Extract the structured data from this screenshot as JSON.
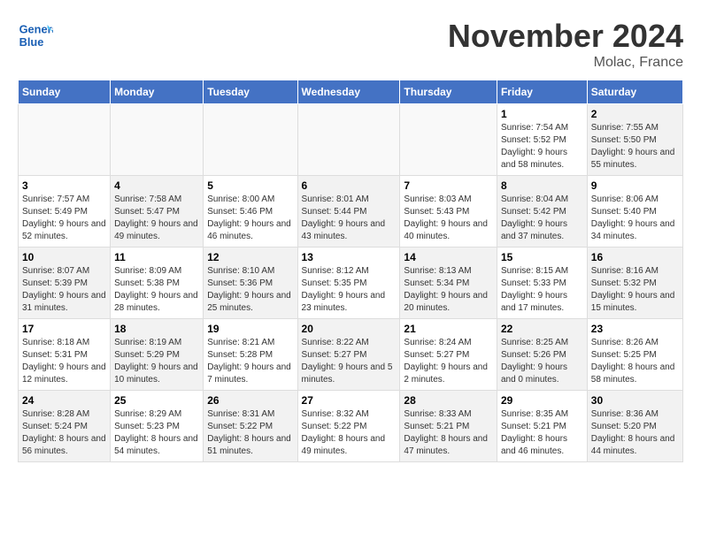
{
  "header": {
    "logo_line1": "General",
    "logo_line2": "Blue",
    "month_title": "November 2024",
    "location": "Molac, France"
  },
  "weekdays": [
    "Sunday",
    "Monday",
    "Tuesday",
    "Wednesday",
    "Thursday",
    "Friday",
    "Saturday"
  ],
  "weeks": [
    [
      {
        "day": "",
        "info": "",
        "shaded": true
      },
      {
        "day": "",
        "info": "",
        "shaded": true
      },
      {
        "day": "",
        "info": "",
        "shaded": true
      },
      {
        "day": "",
        "info": "",
        "shaded": true
      },
      {
        "day": "",
        "info": "",
        "shaded": true
      },
      {
        "day": "1",
        "info": "Sunrise: 7:54 AM\nSunset: 5:52 PM\nDaylight: 9 hours and 58 minutes.",
        "shaded": false
      },
      {
        "day": "2",
        "info": "Sunrise: 7:55 AM\nSunset: 5:50 PM\nDaylight: 9 hours and 55 minutes.",
        "shaded": true
      }
    ],
    [
      {
        "day": "3",
        "info": "Sunrise: 7:57 AM\nSunset: 5:49 PM\nDaylight: 9 hours and 52 minutes.",
        "shaded": false
      },
      {
        "day": "4",
        "info": "Sunrise: 7:58 AM\nSunset: 5:47 PM\nDaylight: 9 hours and 49 minutes.",
        "shaded": true
      },
      {
        "day": "5",
        "info": "Sunrise: 8:00 AM\nSunset: 5:46 PM\nDaylight: 9 hours and 46 minutes.",
        "shaded": false
      },
      {
        "day": "6",
        "info": "Sunrise: 8:01 AM\nSunset: 5:44 PM\nDaylight: 9 hours and 43 minutes.",
        "shaded": true
      },
      {
        "day": "7",
        "info": "Sunrise: 8:03 AM\nSunset: 5:43 PM\nDaylight: 9 hours and 40 minutes.",
        "shaded": false
      },
      {
        "day": "8",
        "info": "Sunrise: 8:04 AM\nSunset: 5:42 PM\nDaylight: 9 hours and 37 minutes.",
        "shaded": true
      },
      {
        "day": "9",
        "info": "Sunrise: 8:06 AM\nSunset: 5:40 PM\nDaylight: 9 hours and 34 minutes.",
        "shaded": false
      }
    ],
    [
      {
        "day": "10",
        "info": "Sunrise: 8:07 AM\nSunset: 5:39 PM\nDaylight: 9 hours and 31 minutes.",
        "shaded": true
      },
      {
        "day": "11",
        "info": "Sunrise: 8:09 AM\nSunset: 5:38 PM\nDaylight: 9 hours and 28 minutes.",
        "shaded": false
      },
      {
        "day": "12",
        "info": "Sunrise: 8:10 AM\nSunset: 5:36 PM\nDaylight: 9 hours and 25 minutes.",
        "shaded": true
      },
      {
        "day": "13",
        "info": "Sunrise: 8:12 AM\nSunset: 5:35 PM\nDaylight: 9 hours and 23 minutes.",
        "shaded": false
      },
      {
        "day": "14",
        "info": "Sunrise: 8:13 AM\nSunset: 5:34 PM\nDaylight: 9 hours and 20 minutes.",
        "shaded": true
      },
      {
        "day": "15",
        "info": "Sunrise: 8:15 AM\nSunset: 5:33 PM\nDaylight: 9 hours and 17 minutes.",
        "shaded": false
      },
      {
        "day": "16",
        "info": "Sunrise: 8:16 AM\nSunset: 5:32 PM\nDaylight: 9 hours and 15 minutes.",
        "shaded": true
      }
    ],
    [
      {
        "day": "17",
        "info": "Sunrise: 8:18 AM\nSunset: 5:31 PM\nDaylight: 9 hours and 12 minutes.",
        "shaded": false
      },
      {
        "day": "18",
        "info": "Sunrise: 8:19 AM\nSunset: 5:29 PM\nDaylight: 9 hours and 10 minutes.",
        "shaded": true
      },
      {
        "day": "19",
        "info": "Sunrise: 8:21 AM\nSunset: 5:28 PM\nDaylight: 9 hours and 7 minutes.",
        "shaded": false
      },
      {
        "day": "20",
        "info": "Sunrise: 8:22 AM\nSunset: 5:27 PM\nDaylight: 9 hours and 5 minutes.",
        "shaded": true
      },
      {
        "day": "21",
        "info": "Sunrise: 8:24 AM\nSunset: 5:27 PM\nDaylight: 9 hours and 2 minutes.",
        "shaded": false
      },
      {
        "day": "22",
        "info": "Sunrise: 8:25 AM\nSunset: 5:26 PM\nDaylight: 9 hours and 0 minutes.",
        "shaded": true
      },
      {
        "day": "23",
        "info": "Sunrise: 8:26 AM\nSunset: 5:25 PM\nDaylight: 8 hours and 58 minutes.",
        "shaded": false
      }
    ],
    [
      {
        "day": "24",
        "info": "Sunrise: 8:28 AM\nSunset: 5:24 PM\nDaylight: 8 hours and 56 minutes.",
        "shaded": true
      },
      {
        "day": "25",
        "info": "Sunrise: 8:29 AM\nSunset: 5:23 PM\nDaylight: 8 hours and 54 minutes.",
        "shaded": false
      },
      {
        "day": "26",
        "info": "Sunrise: 8:31 AM\nSunset: 5:22 PM\nDaylight: 8 hours and 51 minutes.",
        "shaded": true
      },
      {
        "day": "27",
        "info": "Sunrise: 8:32 AM\nSunset: 5:22 PM\nDaylight: 8 hours and 49 minutes.",
        "shaded": false
      },
      {
        "day": "28",
        "info": "Sunrise: 8:33 AM\nSunset: 5:21 PM\nDaylight: 8 hours and 47 minutes.",
        "shaded": true
      },
      {
        "day": "29",
        "info": "Sunrise: 8:35 AM\nSunset: 5:21 PM\nDaylight: 8 hours and 46 minutes.",
        "shaded": false
      },
      {
        "day": "30",
        "info": "Sunrise: 8:36 AM\nSunset: 5:20 PM\nDaylight: 8 hours and 44 minutes.",
        "shaded": true
      }
    ]
  ]
}
